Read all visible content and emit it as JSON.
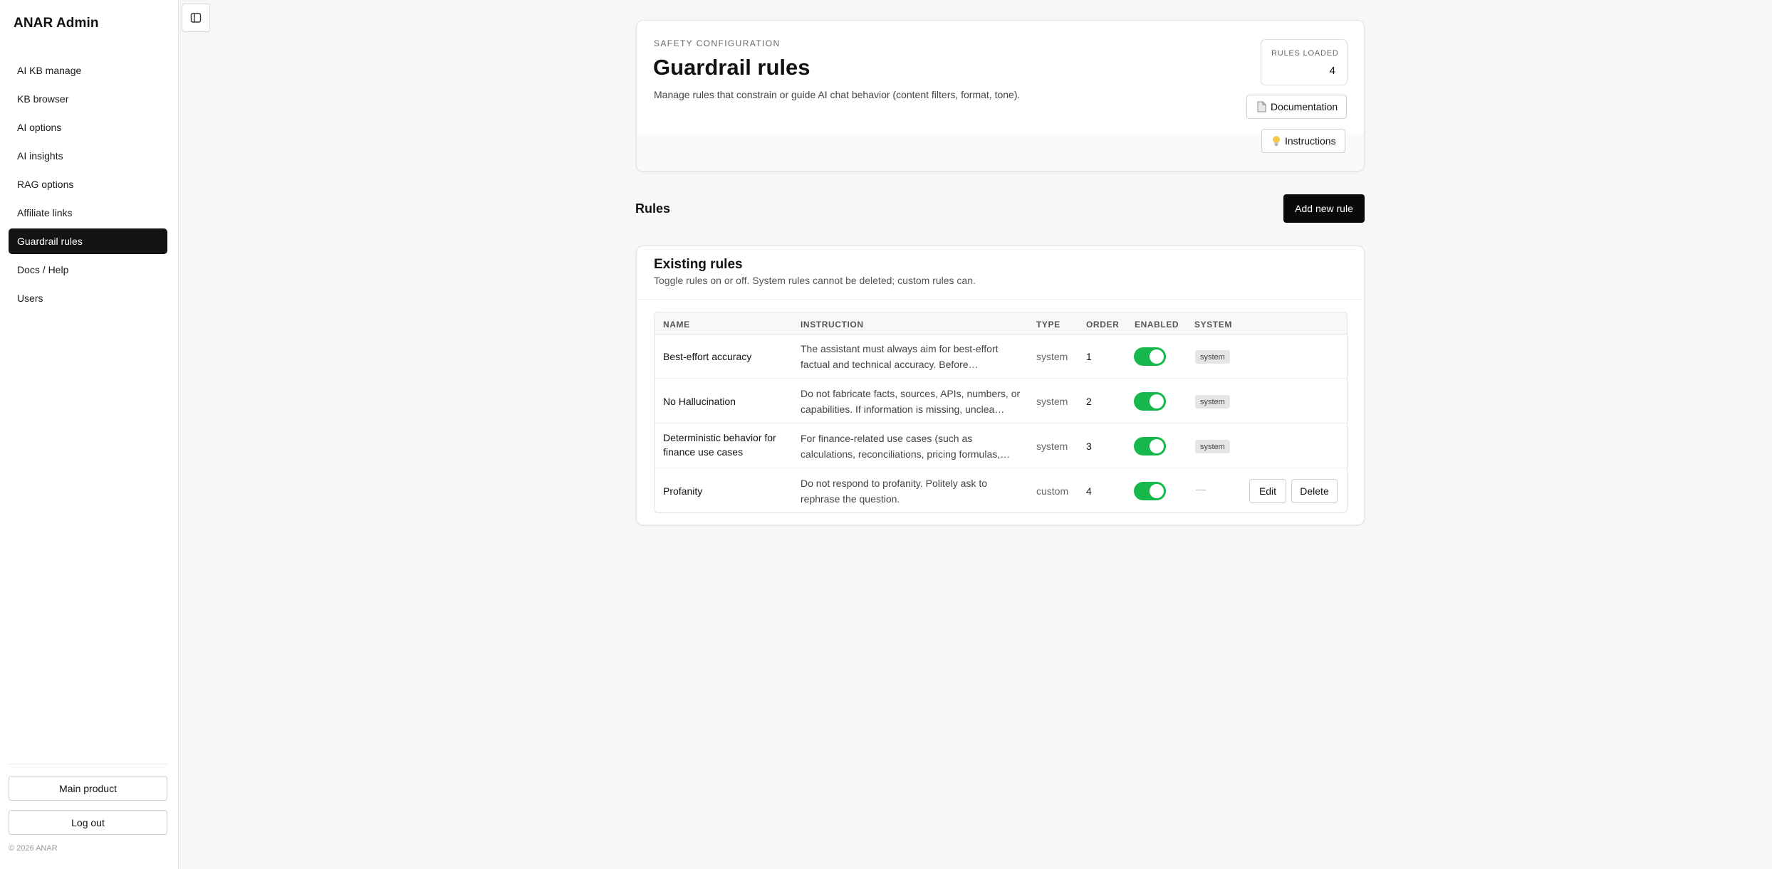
{
  "sidebar": {
    "brand": "ANAR Admin",
    "items": [
      {
        "label": "AI KB manage"
      },
      {
        "label": "KB browser"
      },
      {
        "label": "AI options"
      },
      {
        "label": "AI insights"
      },
      {
        "label": "RAG options"
      },
      {
        "label": "Affiliate links"
      },
      {
        "label": "Guardrail rules",
        "active": true
      },
      {
        "label": "Docs / Help"
      },
      {
        "label": "Users"
      }
    ],
    "main_product_label": "Main product",
    "logout_label": "Log out",
    "copyright": "© 2026 ANAR"
  },
  "toggle_icon": "sidebar-toggle-icon",
  "header": {
    "eyebrow": "SAFETY CONFIGURATION",
    "title": "Guardrail rules",
    "description": "Manage rules that constrain or guide AI chat behavior (content filters, format, tone).",
    "stat_label": "RULES LOADED",
    "stat_value": "4",
    "documentation_label": "Documentation",
    "documentation_icon": "document-icon",
    "instructions_label": "Instructions",
    "instructions_icon": "lightbulb-icon"
  },
  "rules": {
    "heading": "Rules",
    "add_label": "Add new rule"
  },
  "existing": {
    "title": "Existing rules",
    "subtitle": "Toggle rules on or off. System rules cannot be deleted; custom rules can.",
    "columns": [
      "NAME",
      "INSTRUCTION",
      "TYPE",
      "ORDER",
      "ENABLED",
      "SYSTEM"
    ],
    "rows": [
      {
        "name": "Best-effort accuracy",
        "instruction": "The assistant must always aim for best-effort factual and technical accuracy. Before…",
        "type": "system",
        "order": "1",
        "enabled": true,
        "system": "system"
      },
      {
        "name": "No Hallucination",
        "instruction": "Do not fabricate facts, sources, APIs, numbers, or capabilities. If information is missing, unclea…",
        "type": "system",
        "order": "2",
        "enabled": true,
        "system": "system"
      },
      {
        "name": "Deterministic behavior for finance use cases",
        "instruction": "For finance-related use cases (such as calculations, reconciliations, pricing formulas,…",
        "type": "system",
        "order": "3",
        "enabled": true,
        "system": "system"
      },
      {
        "name": "Profanity",
        "instruction": "Do not respond to profanity. Politely ask to rephrase the question.",
        "type": "custom",
        "order": "4",
        "enabled": true,
        "system": "—",
        "edit_label": "Edit",
        "delete_label": "Delete"
      }
    ]
  },
  "colors": {
    "accent_dark": "#141414",
    "toggle_on": "#16b84b"
  }
}
